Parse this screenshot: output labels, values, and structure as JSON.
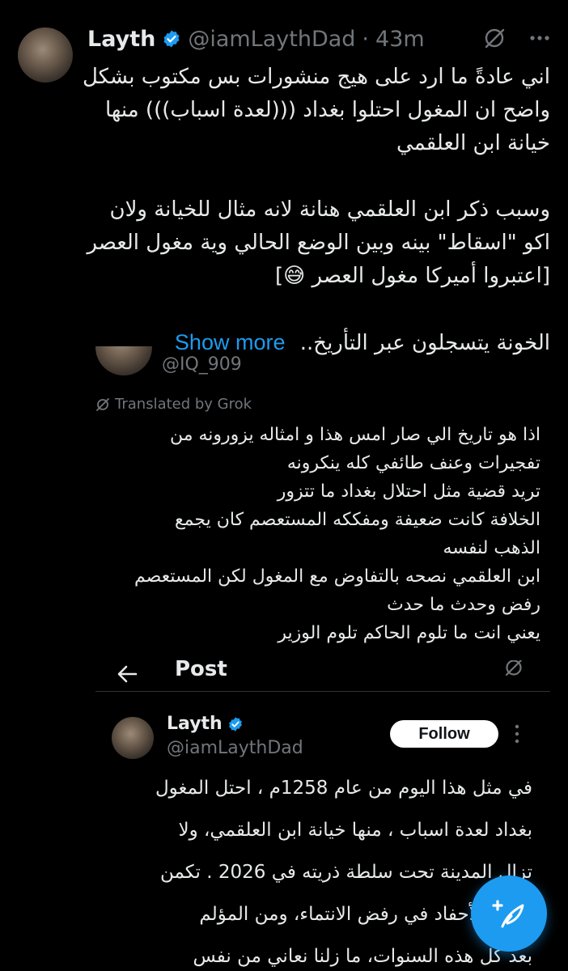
{
  "tweet": {
    "author_name": "Layth",
    "author_handle": "@iamLaythDad",
    "separator": "·",
    "time": "43m",
    "body_lines": [
      "اني عادةً ما ارد على هيج منشورات بس مكتوب بشكل",
      "واضح ان المغول احتلوا بغداد (((لعدة اسباب))) منها",
      "خيانة ابن العلقمي",
      "وسبب ذكر ابن العلقمي هنانة لانه مثال للخيانة ولان",
      "اكو \"اسقاط\" بينه وبين الوضع الحالي وية مغول العصر",
      "[اعتبروا أميركا مغول العصر 😅]",
      "الخونة يتسجلون عبر التأريخ.."
    ],
    "show_more": "Show more"
  },
  "reply": {
    "handle": "@IQ_909",
    "translated_label": "Translated by Grok",
    "body_lines": [
      "اذا هو تاريخ الي صار امس هذا و امثاله يزورونه من",
      "تفجيرات وعنف طائفي كله ينكرونه",
      "تريد قضية مثل احتلال بغداد ما تتزور",
      "الخلافة كانت ضعيفة ومفككه المستعصم كان يجمع",
      "الذهب لنفسه",
      "ابن العلقمي نصحه بالتفاوض مع المغول لكن المستعصم",
      "رفض وحدث ما حدث",
      "يعني انت ما تلوم الحاكم تلوم الوزير"
    ]
  },
  "embedded": {
    "header_title": "Post",
    "author_name": "Layth",
    "author_handle": "@iamLaythDad",
    "follow_label": "Follow",
    "body_lines": [
      "في مثل هذا اليوم من عام 1258م ، احتل المغول",
      "بغداد لعدة اسباب ، منها خيانة ابن العلقمي، ولا",
      "تزال المدينة تحت سلطة ذريته في 2026 . تكمن",
      "الجد والأحفاد في رفض الانتماء، ومن المؤلم",
      "بعد كل هذه السنوات، ما زلنا نعاني من نفس"
    ]
  },
  "colors": {
    "background": "#000000",
    "text": "#e7e9ea",
    "muted": "#71767b",
    "accent": "#1d9bf0"
  },
  "icons": [
    "verified-badge-icon",
    "grok-icon",
    "more-icon",
    "back-arrow-icon",
    "compose-icon"
  ]
}
